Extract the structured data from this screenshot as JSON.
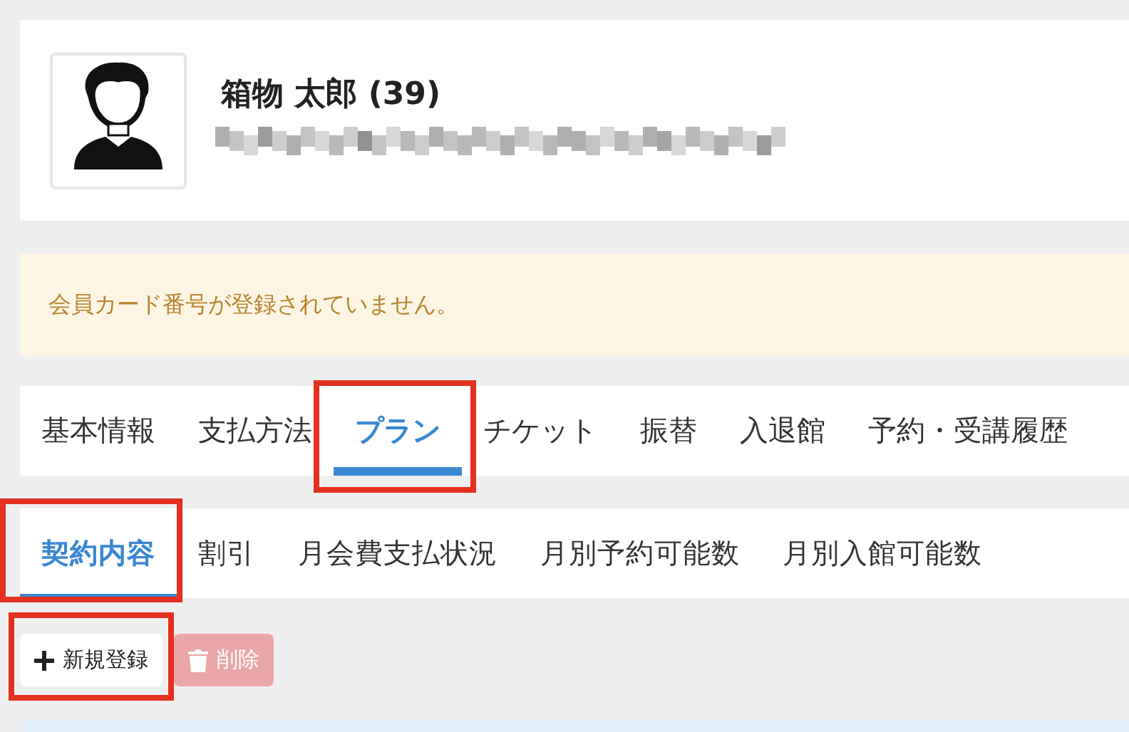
{
  "profile": {
    "name": "箱物 太郎 (39)"
  },
  "alert": {
    "message": "会員カード番号が登録されていません。"
  },
  "tabs": [
    {
      "label": "基本情報",
      "selected": false,
      "highlighted": false
    },
    {
      "label": "支払方法",
      "selected": false,
      "highlighted": false
    },
    {
      "label": "プラン",
      "selected": true,
      "highlighted": true
    },
    {
      "label": "チケット",
      "selected": false,
      "highlighted": false
    },
    {
      "label": "振替",
      "selected": false,
      "highlighted": false
    },
    {
      "label": "入退館",
      "selected": false,
      "highlighted": false
    },
    {
      "label": "予約・受講履歴",
      "selected": false,
      "highlighted": false
    }
  ],
  "subtabs": [
    {
      "label": "契約内容",
      "selected": true,
      "highlighted": true
    },
    {
      "label": "割引",
      "selected": false,
      "highlighted": false
    },
    {
      "label": "月会費支払状況",
      "selected": false,
      "highlighted": false
    },
    {
      "label": "月別予約可能数",
      "selected": false,
      "highlighted": false
    },
    {
      "label": "月別入館可能数",
      "selected": false,
      "highlighted": false
    }
  ],
  "actions": [
    {
      "kind": "add",
      "label": "新規登録",
      "disabled": false,
      "highlighted": true
    },
    {
      "kind": "delete",
      "label": "削除",
      "disabled": true,
      "highlighted": false
    }
  ]
}
